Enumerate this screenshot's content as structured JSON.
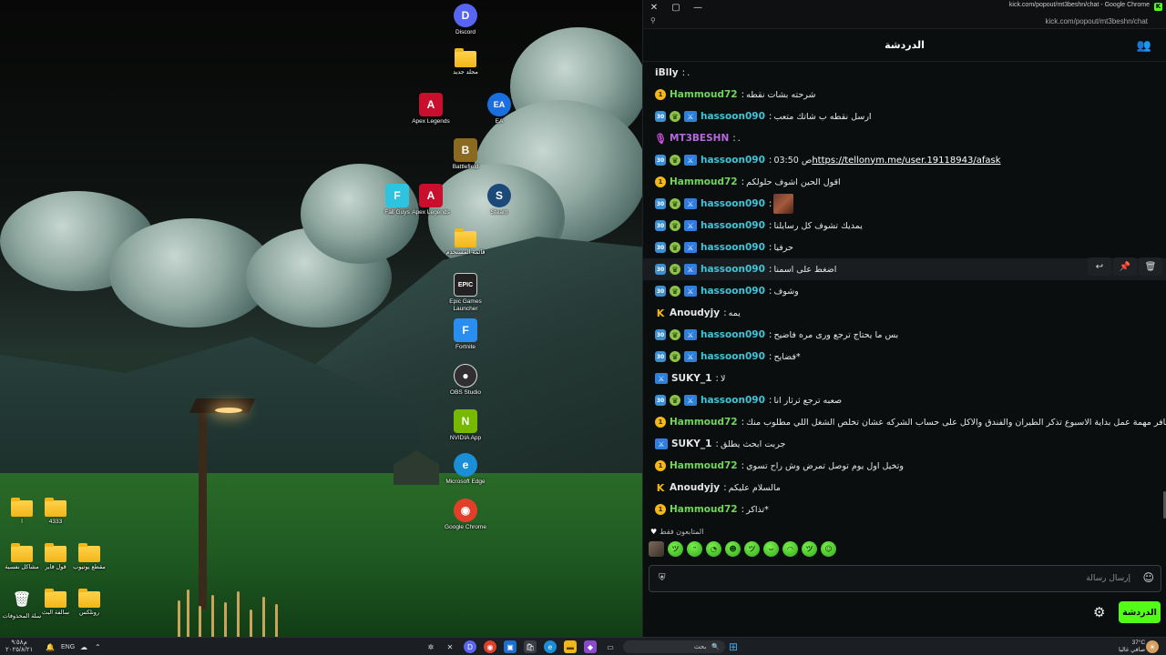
{
  "desktop": {
    "icons": [
      {
        "id": "discord",
        "label": "Discord",
        "glyph": "D",
        "color": "#5865f2"
      },
      {
        "id": "new-folder",
        "label": "مجلد جديد",
        "glyph": "",
        "color": "#f2b619"
      },
      {
        "id": "apex1",
        "label": "Apex Legends",
        "glyph": "A",
        "color": "#c8102e"
      },
      {
        "id": "ea",
        "label": "EA",
        "glyph": "EA",
        "color": "#1a6fe0"
      },
      {
        "id": "battlefield",
        "label": "Battlefield",
        "glyph": "B",
        "color": "#8a6a20"
      },
      {
        "id": "fallguys",
        "label": "Fall Guys",
        "glyph": "F",
        "color": "#2ec4e0"
      },
      {
        "id": "apex2",
        "label": "Apex Legends",
        "glyph": "A",
        "color": "#c8102e"
      },
      {
        "id": "steam",
        "label": "Steam",
        "glyph": "S",
        "color": "#1b4a7a"
      },
      {
        "id": "folder-mid",
        "label": "قائمة المستخدم",
        "glyph": "",
        "color": "#f2b619"
      },
      {
        "id": "epic",
        "label": "Epic Games Launcher",
        "glyph": "EPIC",
        "color": "#222"
      },
      {
        "id": "fortnite",
        "label": "Fortnite",
        "glyph": "F",
        "color": "#2a8ef0"
      },
      {
        "id": "obs",
        "label": "OBS Studio",
        "glyph": "●",
        "color": "#302e31"
      },
      {
        "id": "nvidia",
        "label": "NVIDIA App",
        "glyph": "N",
        "color": "#76b900"
      },
      {
        "id": "edge",
        "label": "Microsoft Edge",
        "glyph": "e",
        "color": "#1a8fd8"
      },
      {
        "id": "chrome",
        "label": "Google Chrome",
        "glyph": "◉",
        "color": "#e0402a"
      },
      {
        "id": "folder-a",
        "label": "ا",
        "glyph": "",
        "color": "#f2b619"
      },
      {
        "id": "folder-4333",
        "label": "4333",
        "glyph": "",
        "color": "#f2b619"
      },
      {
        "id": "folder-b",
        "label": "مشاكل نفسية",
        "glyph": "",
        "color": "#f2b619"
      },
      {
        "id": "folder-c",
        "label": "قول قاير",
        "glyph": "",
        "color": "#f2b619"
      },
      {
        "id": "folder-d",
        "label": "مقطع يوتيوب",
        "glyph": "",
        "color": "#f2b619"
      },
      {
        "id": "recycle",
        "label": "سلة المحذوفات",
        "glyph": "🗑",
        "color": "#5a6a7a"
      },
      {
        "id": "folder-e",
        "label": "سالفة البث",
        "glyph": "",
        "color": "#f2b619"
      },
      {
        "id": "folder-f",
        "label": "رونلكس",
        "glyph": "",
        "color": "#f2b619"
      }
    ]
  },
  "browser": {
    "window_title": "kick.com/popout/mt3beshn/chat - Google Chrome",
    "url": "kick.com/popout/mt3beshn/chat"
  },
  "chat": {
    "title": "الدردشة",
    "messages": [
      {
        "badges": [],
        "user": "iBlly",
        "color": "#e6e6e6",
        "text": ".",
        "link": "",
        "emote": false
      },
      {
        "badges": [
          "og"
        ],
        "user": "Hammoud72",
        "color": "#72d65a",
        "text": "شرحته بشات نقطه",
        "link": "",
        "emote": false
      },
      {
        "badges": [
          "sub",
          "mod",
          "vip"
        ],
        "user": "hassoon090",
        "color": "#3ec6d9",
        "text": "ارسل نقطه ب شاتك متعب",
        "link": "",
        "emote": false
      },
      {
        "badges": [
          "mic"
        ],
        "user": "MT3BESHN",
        "color": "#b66ae0",
        "text": ".",
        "link": "",
        "emote": false
      },
      {
        "badges": [
          "sub",
          "mod",
          "vip"
        ],
        "user": "hassoon090",
        "color": "#3ec6d9",
        "text": "03:50 ص",
        "link": "https://tellonym.me/user.19118943/afask",
        "emote": false
      },
      {
        "badges": [
          "og"
        ],
        "user": "Hammoud72",
        "color": "#72d65a",
        "text": "اقول الحين اشوف حلولكم",
        "link": "",
        "emote": false
      },
      {
        "badges": [
          "sub",
          "mod",
          "vip"
        ],
        "user": "hassoon090",
        "color": "#3ec6d9",
        "text": "",
        "link": "",
        "emote": true
      },
      {
        "badges": [
          "sub",
          "mod",
          "vip"
        ],
        "user": "hassoon090",
        "color": "#3ec6d9",
        "text": "يمديك تشوف كل رسايلنا",
        "link": "",
        "emote": false
      },
      {
        "badges": [
          "sub",
          "mod",
          "vip"
        ],
        "user": "hassoon090",
        "color": "#3ec6d9",
        "text": "حرفيا",
        "link": "",
        "emote": false
      },
      {
        "badges": [
          "sub",
          "mod",
          "vip"
        ],
        "user": "hassoon090",
        "color": "#3ec6d9",
        "text": "اضغط على اسمنا",
        "link": "",
        "emote": false
      },
      {
        "badges": [
          "sub",
          "mod",
          "vip"
        ],
        "user": "hassoon090",
        "color": "#3ec6d9",
        "text": "وشوف",
        "link": "",
        "emote": false
      },
      {
        "badges": [
          "k"
        ],
        "user": "Anoudyjy",
        "color": "#e6e6e6",
        "text": "يمه",
        "link": "",
        "emote": false
      },
      {
        "badges": [
          "sub",
          "mod",
          "vip"
        ],
        "user": "hassoon090",
        "color": "#3ec6d9",
        "text": "بس ما يحتاج ترجع ورى مره فاضيح",
        "link": "",
        "emote": false
      },
      {
        "badges": [
          "sub",
          "mod",
          "vip"
        ],
        "user": "hassoon090",
        "color": "#3ec6d9",
        "text": "فضايح*",
        "link": "",
        "emote": false
      },
      {
        "badges": [
          "vip"
        ],
        "user": "SUKY_1",
        "color": "#e6e6e6",
        "text": "لا",
        "link": "",
        "emote": false
      },
      {
        "badges": [
          "sub",
          "mod",
          "vip"
        ],
        "user": "hassoon090",
        "color": "#3ec6d9",
        "text": "صعبه ترجع ثرثار انا",
        "link": "",
        "emote": false
      },
      {
        "badges": [
          "og"
        ],
        "user": "Hammoud72",
        "color": "#72d65a",
        "text": "تخيل تسافر مهمة عمل بداية الاسبوع تذكر الطيران والفندق والاكل على حساب الشركه عشان تخلص الشغل اللي مطلوب منك",
        "link": "",
        "emote": false
      },
      {
        "badges": [
          "vip"
        ],
        "user": "SUKY_1",
        "color": "#e6e6e6",
        "text": "جربت ابحث يطلق",
        "link": "",
        "emote": false
      },
      {
        "badges": [
          "og"
        ],
        "user": "Hammoud72",
        "color": "#72d65a",
        "text": "وتخيل اول يوم توصل تمرض وش راح تسوي",
        "link": "",
        "emote": false
      },
      {
        "badges": [
          "k"
        ],
        "user": "Anoudyjy",
        "color": "#e6e6e6",
        "text": "مالسلام عليكم",
        "link": "",
        "emote": false
      },
      {
        "badges": [
          "og"
        ],
        "user": "Hammoud72",
        "color": "#72d65a",
        "text": "تذاكر*",
        "link": "",
        "emote": false
      }
    ],
    "subscribers_only_label": "المتابعون فقط",
    "input_placeholder": "إرسال رسالة",
    "send_label": "الدردشة"
  },
  "taskbar": {
    "weather": "37°C",
    "weather_sub": "صافي غالبا",
    "search_placeholder": "بحث",
    "language": "ENG",
    "time": "م٩:٥٨",
    "date": "٢٠٢٥/٨/٢١"
  }
}
